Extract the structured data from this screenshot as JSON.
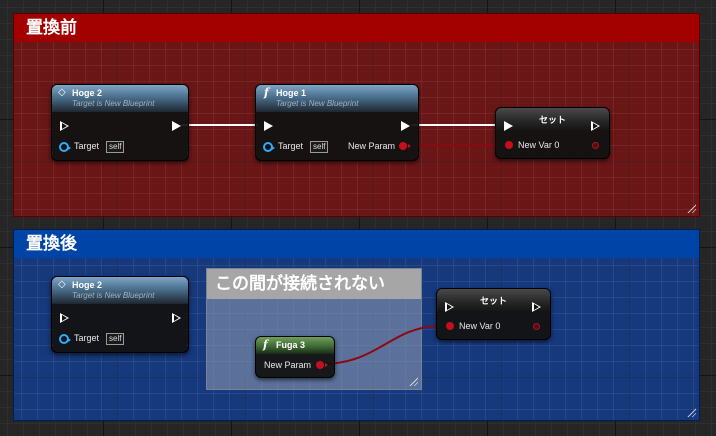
{
  "before": {
    "title": "置換前",
    "color": "#a30000",
    "nodes": {
      "hoge2": {
        "title": "Hoge 2",
        "subtitle": "Target is New Blueprint",
        "target_label": "Target",
        "self_label": "self"
      },
      "hoge1": {
        "title": "Hoge 1",
        "subtitle": "Target is New Blueprint",
        "target_label": "Target",
        "self_label": "self",
        "param_label": "New Param"
      },
      "set": {
        "title": "セット",
        "var_label": "New Var 0"
      }
    }
  },
  "after": {
    "title": "置換後",
    "color": "#0044a8",
    "nodes": {
      "hoge2": {
        "title": "Hoge 2",
        "subtitle": "Target is New Blueprint",
        "target_label": "Target",
        "self_label": "self"
      },
      "fuga3": {
        "title": "Fuga 3",
        "param_label": "New Param"
      },
      "set": {
        "title": "セット",
        "var_label": "New Var 0"
      }
    },
    "inner_comment": {
      "title": "この間が接続されない"
    }
  },
  "colors": {
    "exec_wire": "#ffffff",
    "data_wire": "#8a0a14",
    "pin_object": "#2eaaff",
    "pin_red": "#c50f1f"
  },
  "icons": {
    "event": "diamond-icon",
    "function": "function-f-icon"
  }
}
